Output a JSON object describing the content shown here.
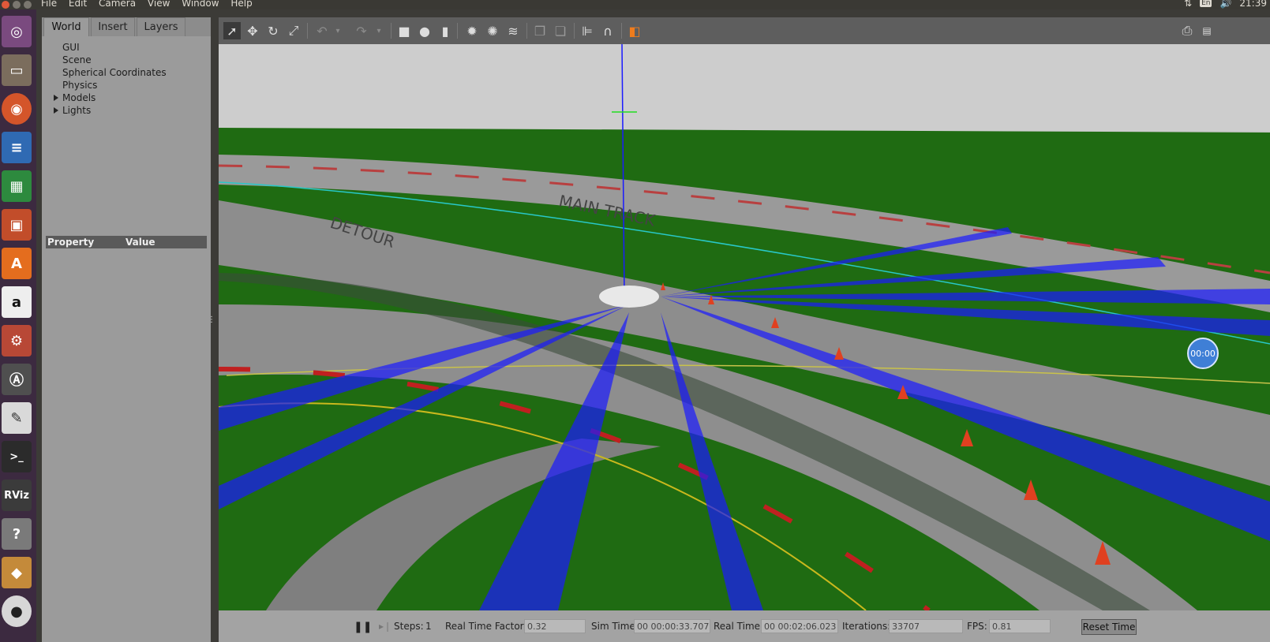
{
  "menubar": {
    "items": [
      "File",
      "Edit",
      "Camera",
      "View",
      "Window",
      "Help"
    ],
    "tray": {
      "lang": "En",
      "clock": "21:39"
    }
  },
  "launcher": {
    "items": [
      "ubuntu-dash",
      "files",
      "firefox",
      "writer",
      "calc",
      "impress",
      "software-center",
      "amazon",
      "system-settings",
      "software-updater",
      "text-editor",
      "terminal",
      "rviz",
      "help",
      "package",
      "dvd"
    ],
    "rviz_label": "RViz"
  },
  "left_panel": {
    "tabs": [
      "World",
      "Insert",
      "Layers"
    ],
    "active_tab": "World",
    "tree": [
      "GUI",
      "Scene",
      "Spherical Coordinates",
      "Physics",
      "Models",
      "Lights"
    ],
    "property_header": "Property",
    "value_header": "Value"
  },
  "viewport": {
    "track_labels": [
      "MAIN TRACK",
      "DETOUR"
    ],
    "timer_label": "00:00"
  },
  "bottom_bar": {
    "steps_label": "Steps:",
    "steps_value": "1",
    "rtf_label": "Real Time Factor:",
    "rtf_value": "0.32",
    "sim_time_label": "Sim Time:",
    "sim_time_value": "00 00:00:33.707",
    "real_time_label": "Real Time:",
    "real_time_value": "00 00:02:06.023",
    "iterations_label": "Iterations:",
    "iterations_value": "33707",
    "fps_label": "FPS:",
    "fps_value": "0.81",
    "reset_label": "Reset Time"
  },
  "colors": {
    "grass": "#1f6b12",
    "road": "#8d8d8d",
    "laser": "#1a1aff",
    "panel": "#9b9b9b",
    "launcher": "#3c2a40"
  }
}
